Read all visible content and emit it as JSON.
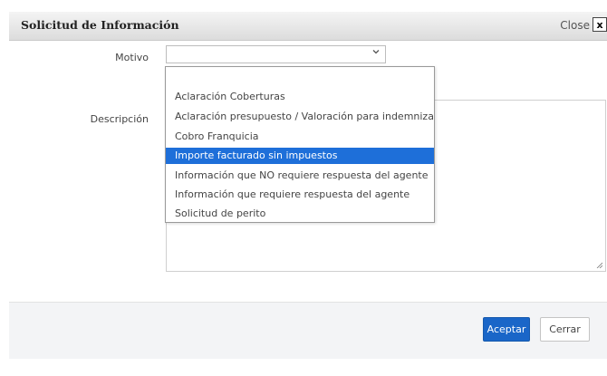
{
  "dialog": {
    "title": "Solicitud de Información",
    "close_label": "Close",
    "close_glyph": "x"
  },
  "form": {
    "motivo_label": "Motivo",
    "motivo_value": "",
    "descripcion_label": "Descripción",
    "descripcion_value": ""
  },
  "dropdown": {
    "options": [
      "",
      "Aclaración Coberturas",
      "Aclaración presupuesto / Valoración para indemnizar",
      "Cobro Franquicia",
      "Importe facturado sin impuestos",
      "Información que NO requiere respuesta del agente",
      "Información que requiere respuesta del agente",
      "Solicitud de perito"
    ],
    "highlighted_index": 4
  },
  "footer": {
    "accept_label": "Aceptar",
    "close_label": "Cerrar"
  },
  "colors": {
    "accent": "#1a66c8",
    "highlight": "#1e6fd9"
  }
}
